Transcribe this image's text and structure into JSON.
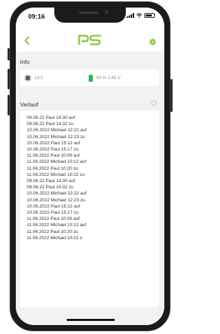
{
  "status_bar": {
    "time": "09:16"
  },
  "header": {
    "logo_text": "PS",
    "back_icon": "chevron-left-icon",
    "settings_icon": "gear-icon",
    "accent_color": "#8dc63f"
  },
  "info": {
    "title": "Info",
    "chip_value": "19.5",
    "battery_text": "93 % 2.85 V"
  },
  "history": {
    "title": "Verlauf",
    "entries": [
      "09.06.22 Paul 14:30 auf",
      "09.06.22 Paul 14:32 zu",
      "10.06.2022 Michael 12:22 auf",
      "10.06.2022 Michael 12:23 zu",
      "10.06.2022 Paul 15:12 auf",
      "10.06.2022 Paul 15:17 zu",
      "11.06.2022 Paul 10:09 auf",
      "11.06.2022 Michael 10:12 auf",
      "11.06.2022 Paul 10:20 zu",
      "11.06.2022 Michael 10:22 zu",
      "09.06.22 Paul 14:30 auf",
      "09.06.22 Paul 14:32 zu",
      "10.06.2022 Michael 12:22 auf",
      "10.06.2022 Michael 12:23 zu",
      "10.06.2022 Paul 15:12 auf",
      "10.06.2022 Paul 15:17 zu",
      "11.06.2022 Paul 10:09 auf",
      "11.06.2022 Michael 10:12 auf",
      "11.06.2022 Paul 10:20 zu",
      "11.06.2022 Michael 10:22 z"
    ]
  }
}
